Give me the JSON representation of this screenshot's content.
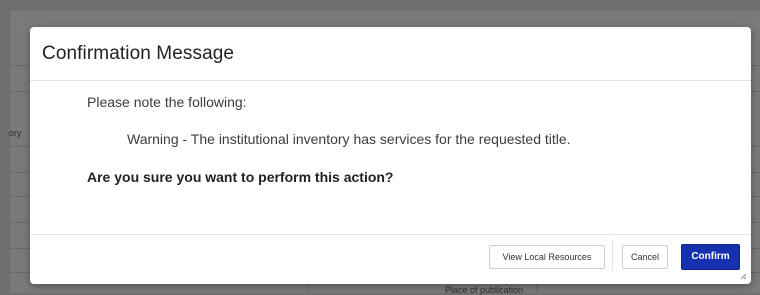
{
  "background": {
    "left_label_fragment": "ory",
    "place_label": "Place of publication"
  },
  "dialog": {
    "title": "Confirmation Message",
    "note_intro": "Please note the following:",
    "warning": "Warning - The institutional inventory has services for the requested title.",
    "question": "Are you sure you want to perform this action?"
  },
  "buttons": {
    "view_local_resources": "View Local Resources",
    "cancel": "Cancel",
    "confirm": "Confirm"
  },
  "colors": {
    "primary": "#1631b0",
    "overlay": "#6f6f6f"
  },
  "icons": {
    "resize_grip": "resize-grip-icon"
  }
}
